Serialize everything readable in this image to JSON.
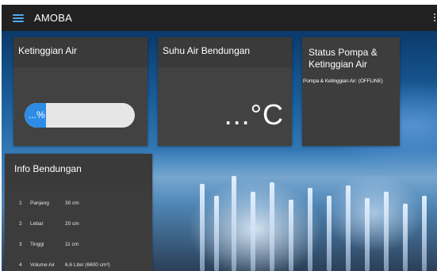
{
  "app": {
    "title": "AMOBA",
    "menu_icon": "hamburger-menu-icon",
    "more_icon": "more-vert-icon"
  },
  "colors": {
    "topbar": "#212121",
    "card": "#3a3a3a",
    "accent": "#2d8ce6",
    "progress_track": "#e6e6e6"
  },
  "cards": {
    "level": {
      "title": "Ketinggian Air",
      "progress_text": "...%"
    },
    "temperature": {
      "title": "Suhu Air Bendungan",
      "value": "...°C"
    },
    "status": {
      "title": "Status Pompa & Ketinggian Air",
      "text": "Pompa & Ketinggian Air: (OFFLINE)"
    },
    "info": {
      "title": "Info Bendungan",
      "rows": [
        {
          "idx": "1",
          "key": "Panjang",
          "value": "30 cm"
        },
        {
          "idx": "2",
          "key": "Lebar",
          "value": "20 cm"
        },
        {
          "idx": "3",
          "key": "Tinggi",
          "value": "11 cm"
        },
        {
          "idx": "4",
          "key": "Volume Air",
          "value": "6.6 Liter (6600 cm³)"
        }
      ]
    }
  }
}
